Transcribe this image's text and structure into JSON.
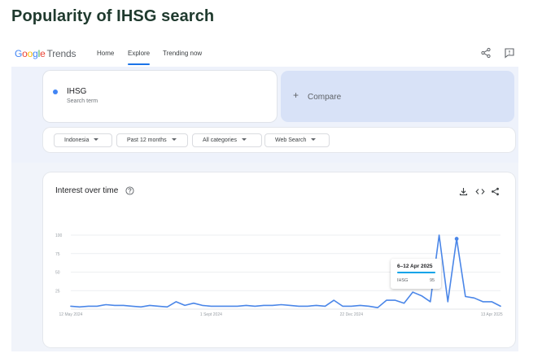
{
  "article_title": "Popularity of IHSG search",
  "header": {
    "logo_google": [
      "G",
      "o",
      "o",
      "g",
      "l",
      "e"
    ],
    "logo_trends": "Trends",
    "nav": {
      "home": "Home",
      "explore": "Explore",
      "trending": "Trending now"
    },
    "active_tab": "Explore"
  },
  "search": {
    "term": "IHSG",
    "term_sub": "Search term",
    "term_color": "#4285f4",
    "compare_plus": "+",
    "compare_label": "Compare"
  },
  "filters": {
    "geo": "Indonesia",
    "time": "Past 12 months",
    "category": "All categories",
    "property": "Web Search"
  },
  "chart": {
    "title": "Interest over time",
    "icons": [
      "help-icon",
      "download-icon",
      "embed-icon",
      "share-icon"
    ]
  },
  "tooltip": {
    "date": "6–12 Apr 2025",
    "term": "IHSG",
    "value": "95"
  },
  "chart_data": {
    "type": "line",
    "title": "Interest over time",
    "line_color": "#4a86e8",
    "x_tick_labels": [
      "12 May 2024",
      "1 Sept 2024",
      "22 Dec 2024",
      "13 Apr 2025"
    ],
    "x_tick_index": [
      0,
      16,
      32,
      48
    ],
    "y_ticks": [
      100,
      75,
      50,
      25
    ],
    "ylim": [
      0,
      100
    ],
    "grid": true,
    "series": [
      {
        "name": "IHSG",
        "values": [
          4,
          3,
          4,
          4,
          6,
          5,
          5,
          4,
          3,
          5,
          4,
          3,
          10,
          5,
          8,
          5,
          4,
          4,
          4,
          4,
          5,
          4,
          5,
          5,
          6,
          5,
          4,
          4,
          5,
          4,
          12,
          4,
          4,
          5,
          4,
          2,
          12,
          12,
          8,
          23,
          18,
          10,
          100,
          10,
          95,
          17,
          15,
          10,
          10,
          4
        ]
      }
    ],
    "highlight_index": 44
  }
}
